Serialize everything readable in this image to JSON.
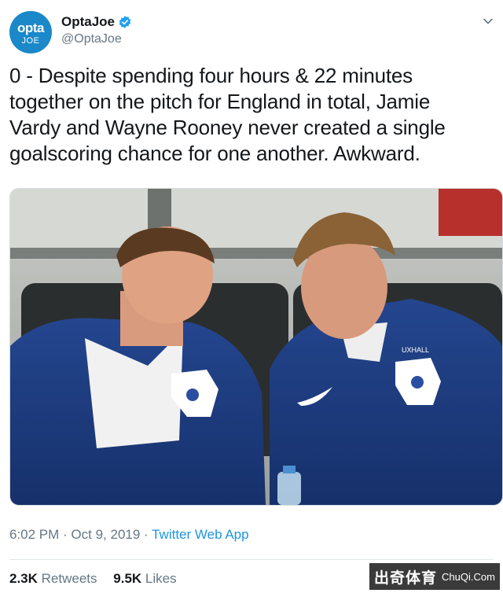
{
  "account": {
    "avatar_text_top": "opta",
    "avatar_text_bottom": "JOE",
    "display_name": "OptaJoe",
    "handle": "@OptaJoe",
    "verified_icon": "verified-badge-icon",
    "menu_icon": "chevron-down-icon"
  },
  "tweet": {
    "text": "0 - Despite spending four hours & 22 minutes\ntogether on the pitch for England in total, Jamie\nVardy and Wayne Rooney never created a single\ngoalscoring chance for one another. Awkward.",
    "timestamp": "6:02 PM · Oct 9, 2019 · ",
    "source": "Twitter Web App"
  },
  "stats": {
    "retweets_count": "2.3K",
    "retweets_label": "Retweets",
    "likes_count": "9.5K",
    "likes_label": "Likes"
  },
  "watermark": {
    "main": "出奇体育",
    "sub": "ChuQi.Com"
  },
  "photo": {
    "shirt_lettering": "UXHALL"
  },
  "colors": {
    "brand_blue": "#1a88c9",
    "link_blue": "#1b95e0",
    "secondary_text": "#657786",
    "jacket_navy": "#1e3a7a"
  }
}
